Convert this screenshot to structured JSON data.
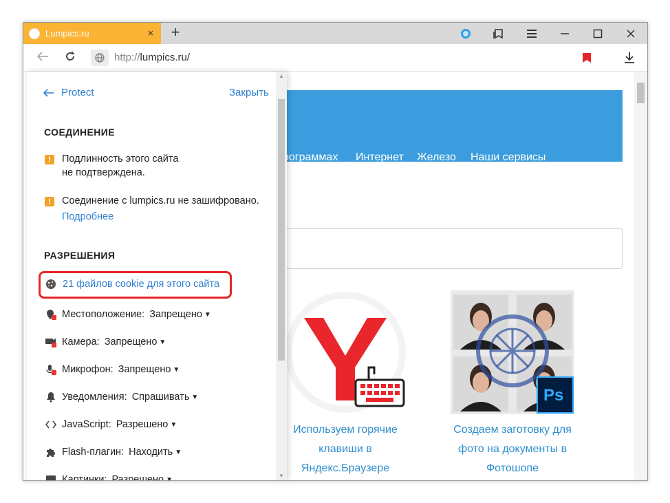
{
  "window": {
    "tab_title": "Lumpics.ru",
    "tab_close": "×",
    "new_tab": "+"
  },
  "toolbar": {
    "url_protocol": "http://",
    "url_host": "lumpics.ru/"
  },
  "site": {
    "nav": [
      "рограммах",
      "Интернет",
      "Железо",
      "Наши сервисы"
    ],
    "cards": [
      {
        "lines": [
          "Используем горячие",
          "клавиши в",
          "Яндекс.Браузере"
        ]
      },
      {
        "lines": [
          "Создаем заготовку для",
          "фото на документы в",
          "Фотошопе"
        ]
      }
    ],
    "ps_label": "Ps"
  },
  "panel": {
    "back_label": "Protect",
    "close_label": "Закрыть",
    "connection_heading": "СОЕДИНЕНИЕ",
    "warning1_line1": "Подлинность этого сайта",
    "warning1_line2": "не подтверждена.",
    "warning2": "Соединение с lumpics.ru не зашифровано.",
    "more_link": "Подробнее",
    "permissions_heading": "РАЗРЕШЕНИЯ",
    "cookies_link": "21 файлов cookie для этого сайта",
    "permissions": [
      {
        "label": "Местоположение:",
        "value": "Запрещено",
        "icon": "location-icon"
      },
      {
        "label": "Камера:",
        "value": "Запрещено",
        "icon": "camera-icon"
      },
      {
        "label": "Микрофон:",
        "value": "Запрещено",
        "icon": "microphone-icon"
      },
      {
        "label": "Уведомления:",
        "value": "Спрашивать",
        "icon": "bell-icon"
      },
      {
        "label": "JavaScript:",
        "value": "Разрешено",
        "icon": "code-icon"
      },
      {
        "label": "Flash-плагин:",
        "value": "Находить",
        "icon": "puzzle-icon"
      },
      {
        "label": "Картинки:",
        "value": "Разрешено",
        "icon": "image-icon"
      }
    ]
  },
  "colors": {
    "tab": "#fab332",
    "accent_link": "#2f7fd0",
    "site_band": "#3b9ddd",
    "highlight": "#e4262b",
    "warning": "#f3a226"
  }
}
